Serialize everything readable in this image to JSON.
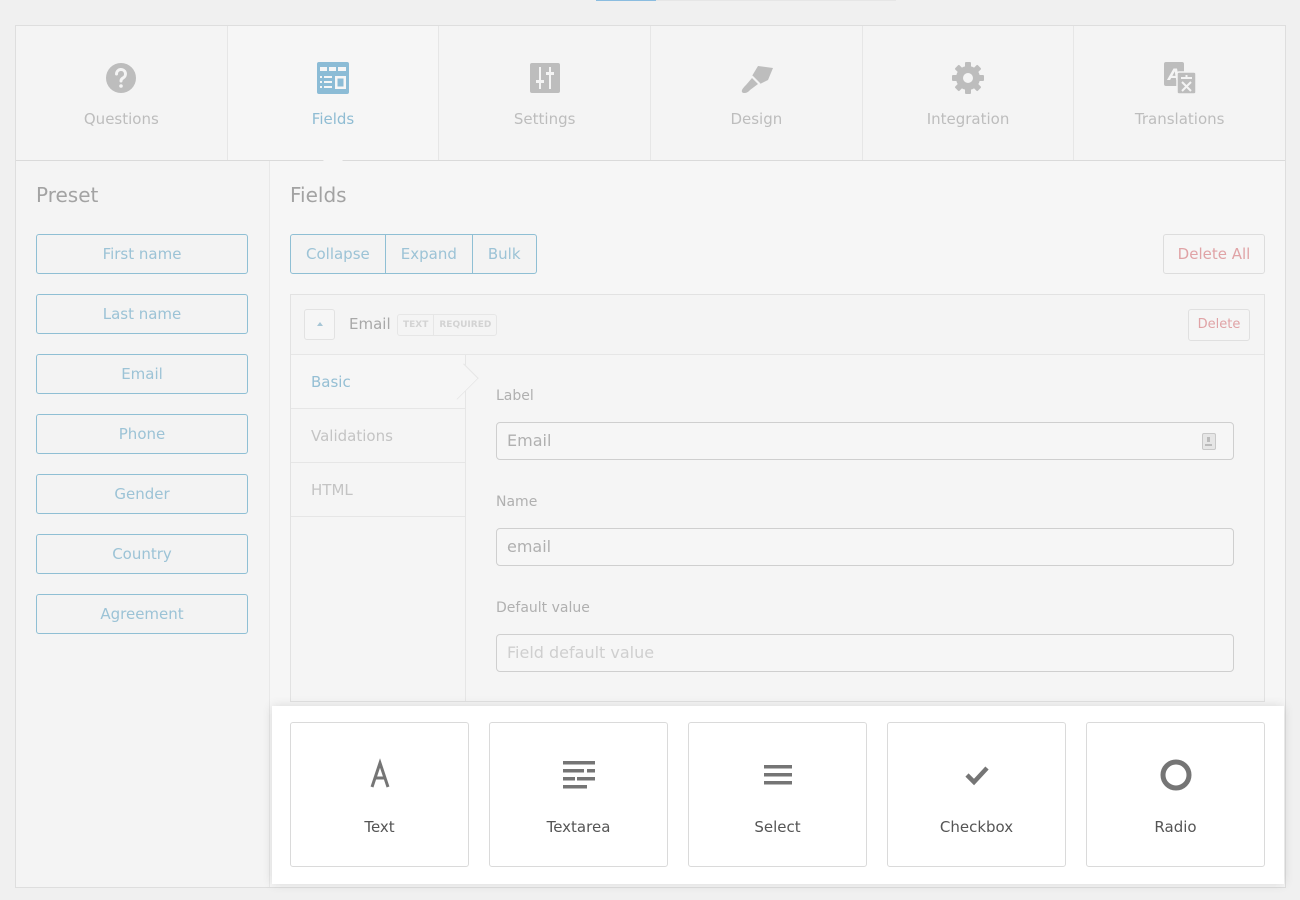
{
  "progress": {
    "value_percent": 20,
    "color": "#8bbde0"
  },
  "tabs": [
    {
      "id": "questions",
      "label": "Questions",
      "icon": "question-circle-icon",
      "active": false
    },
    {
      "id": "fields",
      "label": "Fields",
      "icon": "form-layout-icon",
      "active": true
    },
    {
      "id": "settings",
      "label": "Settings",
      "icon": "sliders-icon",
      "active": false
    },
    {
      "id": "design",
      "label": "Design",
      "icon": "paintbrush-icon",
      "active": false
    },
    {
      "id": "integration",
      "label": "Integration",
      "icon": "gear-icon",
      "active": false
    },
    {
      "id": "translations",
      "label": "Translations",
      "icon": "translate-icon",
      "active": false
    }
  ],
  "preset": {
    "title": "Preset",
    "items": [
      "First name",
      "Last name",
      "Email",
      "Phone",
      "Gender",
      "Country",
      "Agreement"
    ]
  },
  "fields": {
    "title": "Fields",
    "actions": {
      "collapse": "Collapse",
      "expand": "Expand",
      "bulk": "Bulk",
      "delete_all": "Delete All"
    },
    "card": {
      "title": "Email",
      "badges": [
        "TEXT",
        "REQUIRED"
      ],
      "delete_label": "Delete",
      "subtabs": [
        {
          "label": "Basic",
          "active": true
        },
        {
          "label": "Validations",
          "active": false
        },
        {
          "label": "HTML",
          "active": false
        }
      ],
      "form": {
        "label_label": "Label",
        "label_value": "Email",
        "name_label": "Name",
        "name_value": "email",
        "default_label": "Default value",
        "default_placeholder": "Field default value"
      }
    }
  },
  "field_types": [
    {
      "label": "Text",
      "icon": "text-a-icon"
    },
    {
      "label": "Textarea",
      "icon": "textarea-icon"
    },
    {
      "label": "Select",
      "icon": "select-list-icon"
    },
    {
      "label": "Checkbox",
      "icon": "checkmark-icon"
    },
    {
      "label": "Radio",
      "icon": "radio-circle-icon"
    }
  ],
  "colors": {
    "accent": "#8fbcd3",
    "danger": "#e0a3a6",
    "icon_gray": "#bdbdbd",
    "icon_active": "#8cbcd6"
  }
}
